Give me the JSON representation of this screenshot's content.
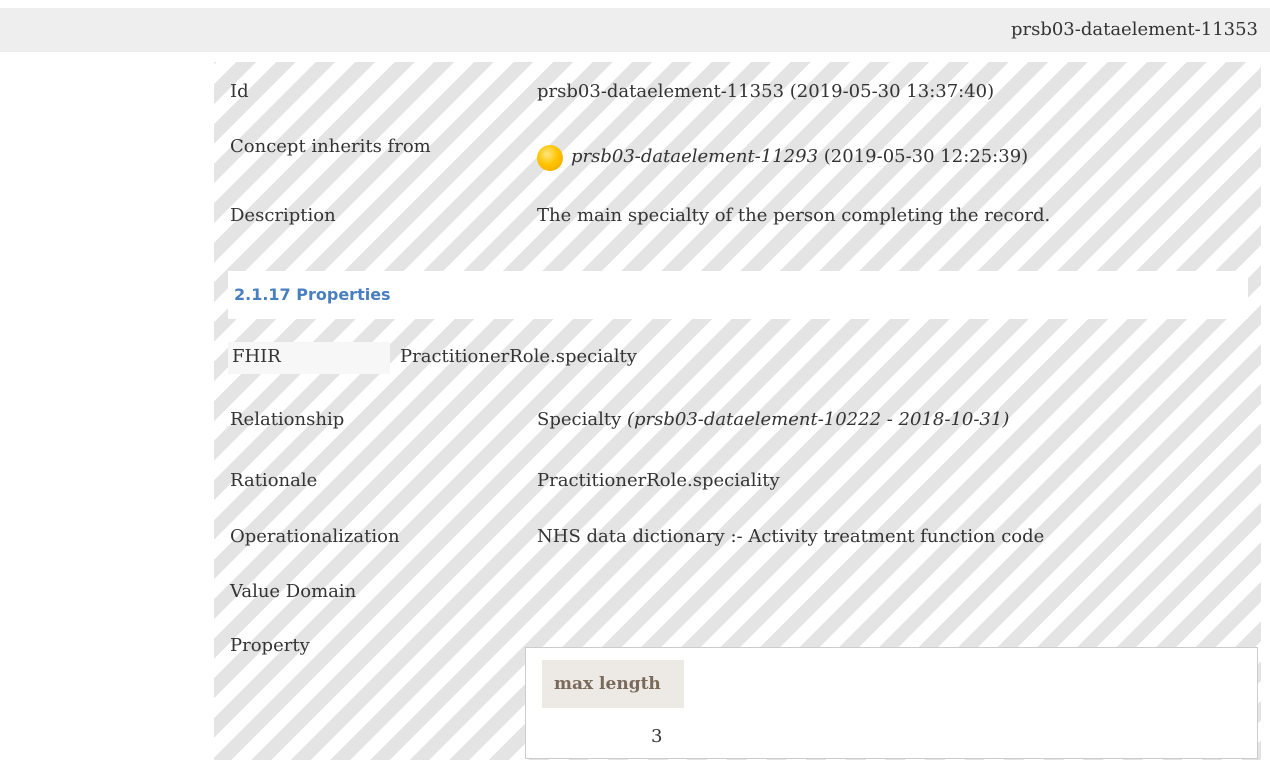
{
  "header": {
    "title": "prsb03-dataelement-11353"
  },
  "rows": {
    "id": {
      "label": "Id",
      "value": "prsb03-dataelement-11353 (2019-05-30 13:37:40)"
    },
    "inherits": {
      "label": "Concept inherits from",
      "ref": "prsb03-dataelement-11293",
      "date": "(2019-05-30 12:25:39)",
      "status_color": "#ffc300"
    },
    "description": {
      "label": "Description",
      "value": "The main specialty of the person completing the record."
    }
  },
  "properties": {
    "heading": "2.1.17 Properties",
    "fhir": {
      "label": "FHIR",
      "value": "PractitionerRole.specialty"
    },
    "relationship": {
      "label": "Relationship",
      "value": "Specialty",
      "ref": "(prsb03-dataelement-10222 - 2018-10-31)"
    },
    "rationale": {
      "label": "Rationale",
      "value": "PractitionerRole.speciality"
    },
    "operationalization": {
      "label": "Operationalization",
      "value": "NHS data dictionary :- Activity treatment function code"
    },
    "value_domain": {
      "label": "Value Domain",
      "value": ""
    },
    "property": {
      "label": "Property",
      "column": "max length",
      "cell": "3"
    }
  }
}
